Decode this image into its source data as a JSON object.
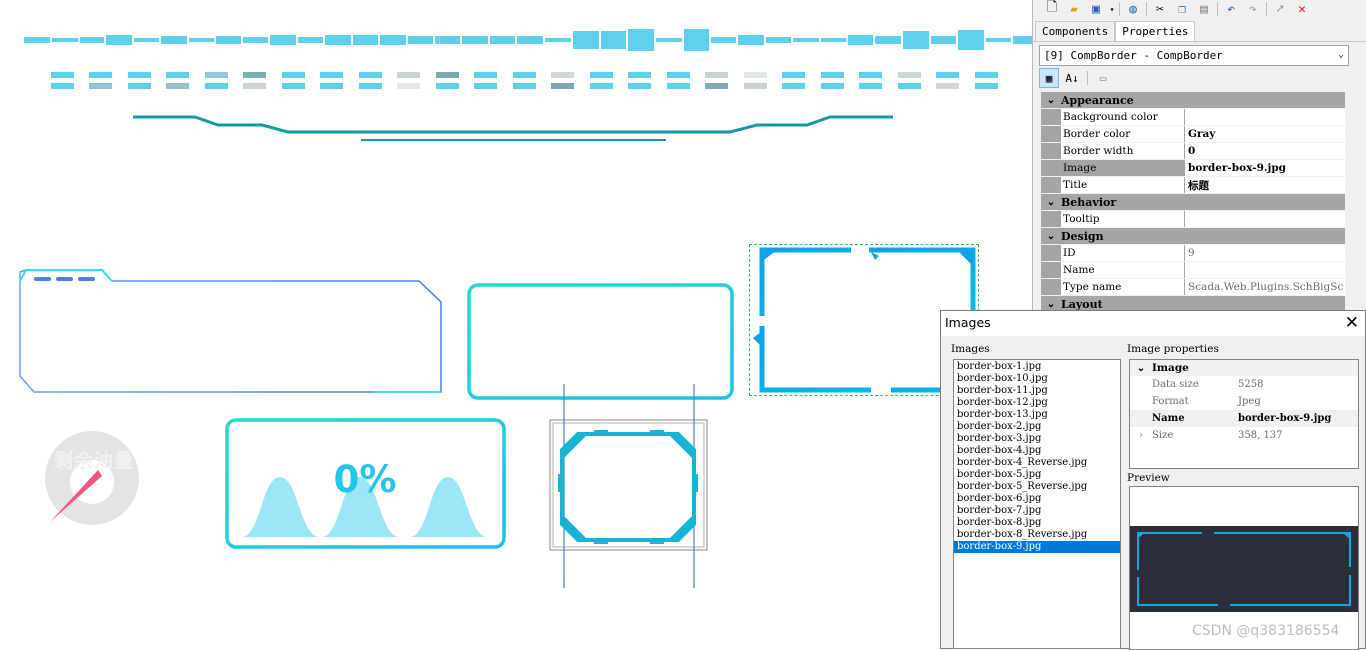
{
  "toolbar": {
    "icons": [
      "new-icon",
      "open-icon",
      "save-icon",
      "dropdown-icon",
      "globe-icon",
      "cut-icon",
      "copy-icon",
      "paste-icon",
      "undo-icon",
      "redo-icon",
      "pointer-icon",
      "delete-icon"
    ]
  },
  "tabs": [
    {
      "label": "Components",
      "active": false
    },
    {
      "label": "Properties",
      "active": true
    }
  ],
  "component_selector": {
    "value": "[9] CompBorder - CompBorder"
  },
  "properties": {
    "appearance": {
      "title": "Appearance",
      "rows": [
        {
          "name": "Background color",
          "value": ""
        },
        {
          "name": "Border color",
          "value": "Gray"
        },
        {
          "name": "Border width",
          "value": "0"
        },
        {
          "name": "Image",
          "value": "border-box-9.jpg"
        },
        {
          "name": "Title",
          "value": "标题"
        }
      ]
    },
    "behavior": {
      "title": "Behavior",
      "rows": [
        {
          "name": "Tooltip",
          "value": ""
        }
      ]
    },
    "design": {
      "title": "Design",
      "rows": [
        {
          "name": "ID",
          "value": "9"
        },
        {
          "name": "Name",
          "value": ""
        },
        {
          "name": "Type name",
          "value": "Scada.Web.Plugins.SchBigSc"
        }
      ]
    },
    "layout": {
      "title": "Layout"
    }
  },
  "images_dialog": {
    "title": "Images",
    "list_label": "Images",
    "props_label": "Image properties",
    "preview_label": "Preview",
    "files": [
      "border-box-1.jpg",
      "border-box-10.jpg",
      "border-box-11.jpg",
      "border-box-12.jpg",
      "border-box-13.jpg",
      "border-box-2.jpg",
      "border-box-3.jpg",
      "border-box-4.jpg",
      "border-box-4_Reverse.jpg",
      "border-box-5.jpg",
      "border-box-5_Reverse.jpg",
      "border-box-6.jpg",
      "border-box-7.jpg",
      "border-box-8.jpg",
      "border-box-8_Reverse.jpg",
      "border-box-9.jpg"
    ],
    "selected_file": "border-box-9.jpg",
    "image_props": {
      "category": "Image",
      "rows": [
        {
          "name": "Data size",
          "value": "5258"
        },
        {
          "name": "Format",
          "value": "Jpeg"
        },
        {
          "name": "Name",
          "value": "border-box-9.jpg"
        },
        {
          "name": "Size",
          "value": "358, 137"
        }
      ]
    }
  },
  "canvas": {
    "percent_text": "0%",
    "gauge_text": "剩余油量"
  },
  "watermark": "CSDN @q383186554",
  "colors": {
    "accent_cyan": "#23c6e6",
    "light_cyan": "#5ecfed",
    "teal_line": "#149aa3",
    "blue_border": "#5b86e5",
    "preview_bg": "#2b2f39",
    "selection": "#0078d7"
  }
}
